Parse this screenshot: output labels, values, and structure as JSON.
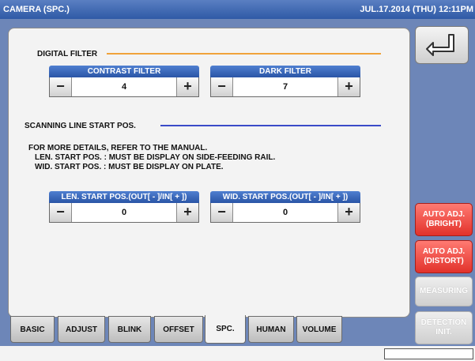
{
  "title_bar": {
    "left": "CAMERA (SPC.)",
    "right": "JUL.17.2014 (THU) 12:11PM"
  },
  "back_button": {
    "icon": "return-arrow-icon"
  },
  "digital_filter": {
    "title": "DIGITAL FILTER",
    "line_color": "#f0a23a",
    "contrast": {
      "label": "CONTRAST FILTER",
      "value": "4",
      "minus": "−",
      "plus": "+"
    },
    "dark": {
      "label": "DARK FILTER",
      "value": "7",
      "minus": "−",
      "plus": "+"
    }
  },
  "scanning": {
    "title": "SCANNING LINE START POS.",
    "line_color": "#3a4bc8",
    "notes": [
      "FOR MORE DETAILS, REFER TO THE MANUAL.",
      "LEN. START POS. : MUST BE DISPLAY ON SIDE-FEEDING RAIL.",
      "WID. START POS. : MUST BE DISPLAY ON PLATE."
    ],
    "len": {
      "label": "LEN. START POS.(OUT[ - ]/IN[ + ])",
      "value": "0",
      "minus": "−",
      "plus": "+"
    },
    "wid": {
      "label": "WID. START POS.(OUT[ - ]/IN[ + ])",
      "value": "0",
      "minus": "−",
      "plus": "+"
    }
  },
  "side_buttons": {
    "auto_bright": "AUTO ADJ.\n(BRIGHT)",
    "auto_distort": "AUTO ADJ.\n(DISTORT)",
    "measuring": "MEASURING",
    "detection_init": "DETECTION\nINIT."
  },
  "tabs": [
    "BASIC",
    "ADJUST",
    "BLINK",
    "OFFSET",
    "SPC.",
    "HUMAN",
    "VOLUME"
  ],
  "active_tab": "SPC."
}
